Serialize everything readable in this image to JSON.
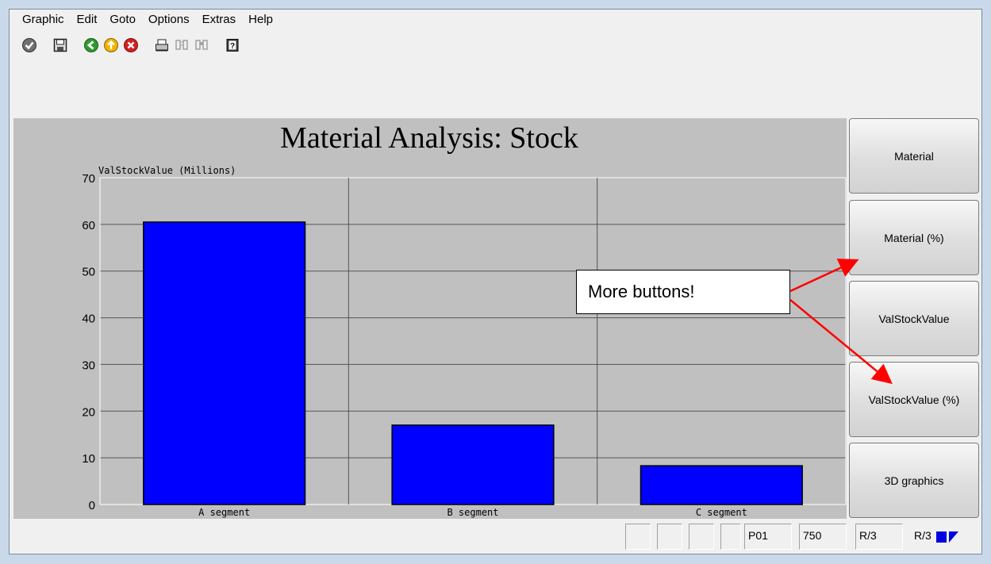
{
  "menu": [
    "Graphic",
    "Edit",
    "Goto",
    "Options",
    "Extras",
    "Help"
  ],
  "toolbar": {
    "icons": [
      "check-icon",
      "save-icon",
      "back-icon",
      "exit-icon",
      "cancel-icon",
      "print-icon",
      "find-icon",
      "find-next-icon",
      "help-icon"
    ]
  },
  "chart_data": {
    "type": "bar",
    "title": "Material Analysis: Stock",
    "ylabel": "ValStockValue (Millions)",
    "xlabel": "",
    "categories": [
      "A segment",
      "B segment",
      "C segment"
    ],
    "values": [
      60.5,
      17,
      8.3
    ],
    "ylim": [
      0,
      70
    ],
    "yticks": [
      0,
      10,
      20,
      30,
      40,
      50,
      60,
      70
    ],
    "bar_color": "#0000ff",
    "grid": true
  },
  "side_buttons": [
    "Material",
    "Material (%)",
    "ValStockValue",
    "ValStockValue (%)",
    "3D graphics"
  ],
  "callout": {
    "text": "More buttons!",
    "arrow_color": "#ff0000"
  },
  "status": {
    "system": "P01",
    "client": "750",
    "release": "R/3",
    "indicator": "R/3"
  }
}
